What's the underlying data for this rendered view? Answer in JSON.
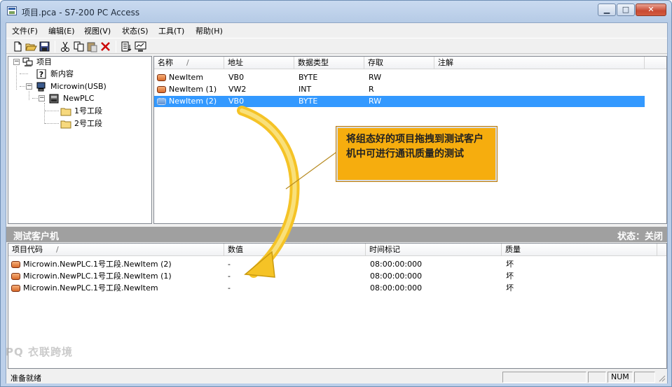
{
  "window": {
    "title": "项目.pca - S7-200 PC Access",
    "minimize_glyph": "▁",
    "maximize_glyph": "□",
    "close_glyph": "✕"
  },
  "menu": [
    "文件(F)",
    "编辑(E)",
    "视图(V)",
    "状态(S)",
    "工具(T)",
    "帮助(H)"
  ],
  "toolbar": {
    "icons": [
      "new-file-icon",
      "open-folder-icon",
      "save-icon",
      "cut-icon",
      "copy-icon",
      "paste-icon",
      "delete-icon",
      "add-item-icon",
      "test-client-icon"
    ]
  },
  "tree": {
    "root": "项目",
    "new_content": "新内容",
    "connection": "Microwin(USB)",
    "plc": "NewPLC",
    "folders": [
      "1号工段",
      "2号工段"
    ]
  },
  "items_table": {
    "headers": [
      "名称",
      "地址",
      "数据类型",
      "存取",
      "注解"
    ],
    "sort_glyph": "/",
    "rows": [
      {
        "name": "NewItem",
        "address": "VB0",
        "type": "BYTE",
        "access": "RW",
        "comment": ""
      },
      {
        "name": "NewItem (1)",
        "address": "VW2",
        "type": "INT",
        "access": "R",
        "comment": ""
      },
      {
        "name": "NewItem (2)",
        "address": "VB0",
        "type": "BYTE",
        "access": "RW",
        "comment": ""
      }
    ],
    "selected_row": 2
  },
  "callout": {
    "text": "将组态好的项目拖拽到测试客户机中可进行通讯质量的测试",
    "color": "#f6ad0e"
  },
  "test_client": {
    "title": "测试客户机",
    "status": "状态：关闭",
    "headers": [
      "项目代码",
      "数值",
      "时间标记",
      "质量"
    ],
    "sort_glyph": "/",
    "rows": [
      {
        "code": "Microwin.NewPLC.1号工段.NewItem (2)",
        "value": "-",
        "timestamp": "08:00:00:000",
        "quality": "坏"
      },
      {
        "code": "Microwin.NewPLC.1号工段.NewItem (1)",
        "value": "-",
        "timestamp": "08:00:00:000",
        "quality": "坏"
      },
      {
        "code": "Microwin.NewPLC.1号工段.NewItem",
        "value": "-",
        "timestamp": "08:00:00:000",
        "quality": "坏"
      }
    ]
  },
  "statusbar": {
    "text": "准备就绪",
    "num": "NUM",
    "watermark": "PQ 衣联跨境"
  }
}
